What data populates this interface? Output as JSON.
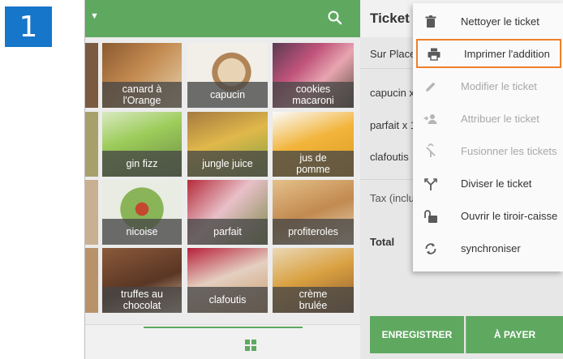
{
  "step_number": "1",
  "products": [
    {
      "name_lines": [
        "canard à",
        "l'Orange"
      ]
    },
    {
      "name_lines": [
        "capucin"
      ]
    },
    {
      "name_lines": [
        "cookies",
        "macaroni"
      ]
    },
    {
      "name_lines": [
        "gin fizz"
      ]
    },
    {
      "name_lines": [
        "jungle juice"
      ]
    },
    {
      "name_lines": [
        "jus de",
        "pomme"
      ]
    },
    {
      "name_lines": [
        "nicoise"
      ]
    },
    {
      "name_lines": [
        "parfait"
      ]
    },
    {
      "name_lines": [
        "profiteroles"
      ]
    },
    {
      "name_lines": [
        "truffes au",
        "chocolat"
      ]
    },
    {
      "name_lines": [
        "clafoutis"
      ]
    },
    {
      "name_lines": [
        "crème",
        "brulée"
      ]
    }
  ],
  "ticket": {
    "title": "Ticket",
    "mode": "Sur Place",
    "lines": [
      "capucin x",
      "parfait x 1",
      "clafoutis"
    ],
    "tax_label": "Tax (inclu",
    "total_label": "Total",
    "save_button": "ENREGISTRER",
    "pay_button": "À PAYER"
  },
  "menu": {
    "items": [
      {
        "label": "Nettoyer le ticket",
        "icon": "trash-icon",
        "disabled": false
      },
      {
        "label": "Imprimer l'addition",
        "icon": "print-icon",
        "disabled": false,
        "highlighted": true
      },
      {
        "label": "Modifier le ticket",
        "icon": "edit-icon",
        "disabled": true
      },
      {
        "label": "Attribuer le ticket",
        "icon": "assign-icon",
        "disabled": true
      },
      {
        "label": "Fusionner les tickets",
        "icon": "merge-icon",
        "disabled": true
      },
      {
        "label": "Diviser le ticket",
        "icon": "split-icon",
        "disabled": false
      },
      {
        "label": "Ouvrir le tiroir-caisse",
        "icon": "cash-drawer-icon",
        "disabled": false
      },
      {
        "label": "synchroniser",
        "icon": "sync-icon",
        "disabled": false
      }
    ]
  },
  "colors": {
    "brand_green": "#5fa860",
    "step_blue": "#1676c9",
    "highlight_orange": "#ef7f2b"
  }
}
